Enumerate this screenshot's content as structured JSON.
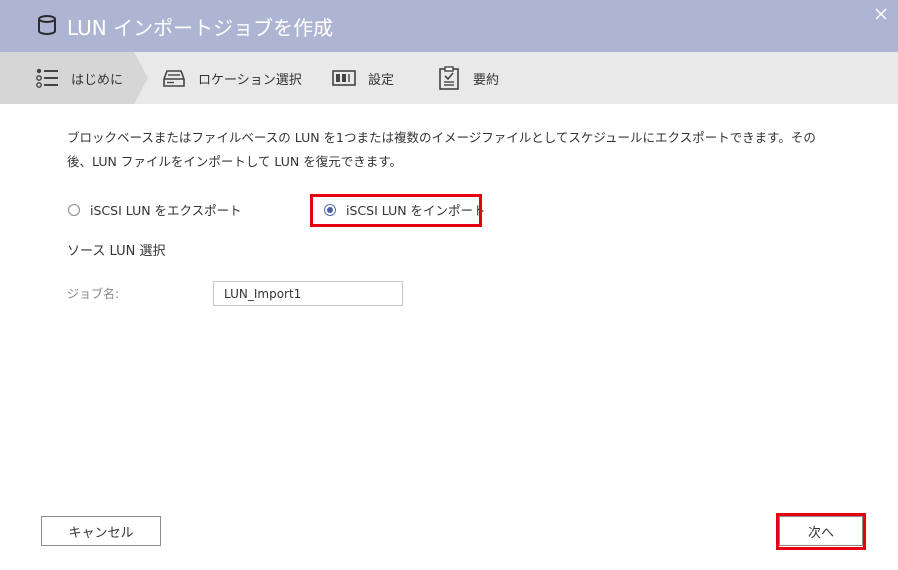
{
  "window": {
    "title": "LUN インポートジョブを作成"
  },
  "steps": [
    {
      "label": "はじめに",
      "icon": "list-icon",
      "active": true
    },
    {
      "label": "ロケーション選択",
      "icon": "storage-drive-icon",
      "active": false
    },
    {
      "label": "設定",
      "icon": "settings-bar-icon",
      "active": false
    },
    {
      "label": "要約",
      "icon": "clipboard-check-icon",
      "active": false
    }
  ],
  "main": {
    "description": "ブロックベースまたはファイルベースの LUN を1つまたは複数のイメージファイルとしてスケジュールにエクスポートできます。その後、LUN ファイルをインポートして LUN を復元できます。",
    "radio_export_label": "iSCSI LUN をエクスポート",
    "radio_import_label": "iSCSI LUN をインポート",
    "selected_option": "import",
    "section_heading": "ソース LUN 選択",
    "job_name_label": "ジョブ名:",
    "job_name_value": "LUN_Import1"
  },
  "footer": {
    "cancel_label": "キャンセル",
    "next_label": "次へ"
  },
  "colors": {
    "titlebar": "#aeb5d3",
    "stepbar": "#e9e9e9",
    "active_step": "#d6d6d6",
    "highlight": "#e60012",
    "radio_accent": "#4a5fa8"
  }
}
